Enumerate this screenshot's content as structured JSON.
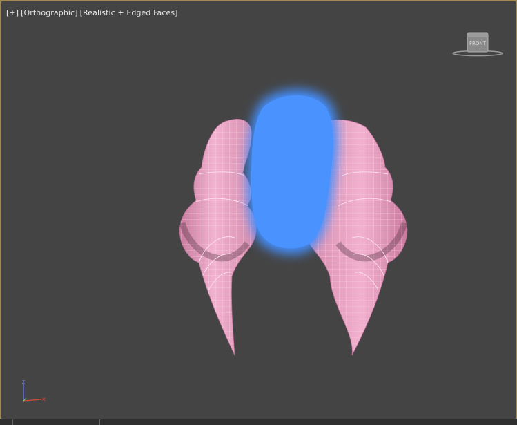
{
  "viewport": {
    "label_plus": "[+]",
    "label_view": "[Orthographic]",
    "label_shading": "[Realistic + Edged Faces]"
  },
  "viewcube": {
    "face_label": "FRONT",
    "icon": "viewcube-icon"
  },
  "axis_gizmo": {
    "x_label": "x",
    "z_label": "z"
  },
  "scene": {
    "model": "pink-horns-mesh",
    "model_color": "#e8a0c0",
    "wire_color": "#ffe6f1",
    "overlay": "blue-blob",
    "overlay_color": "#4590ff"
  },
  "colors": {
    "viewport_bg": "#444444",
    "active_border": "#a08a58"
  }
}
